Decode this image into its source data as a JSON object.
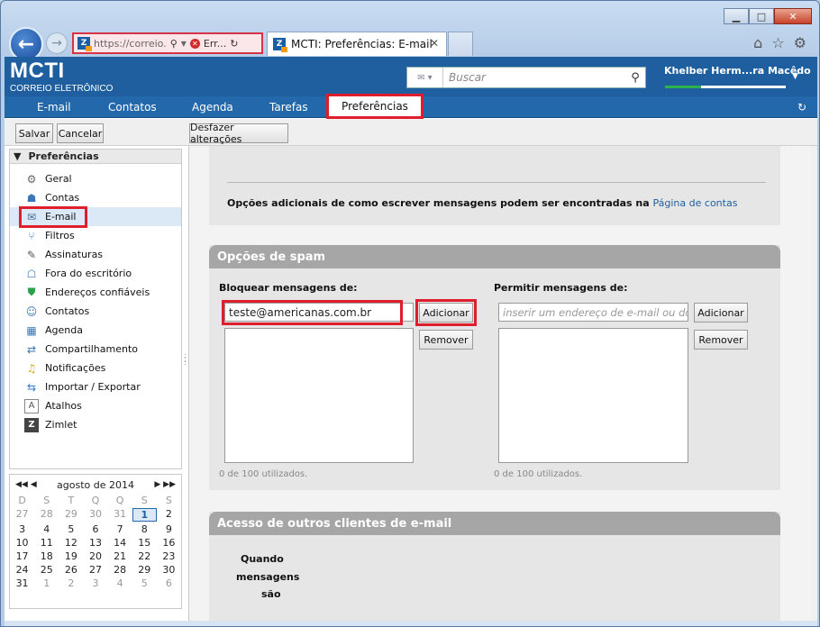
{
  "browser": {
    "address": "https://correio.",
    "error_tab_label": "Err...",
    "active_tab_title": "MCTI: Preferências: E-mail",
    "window_controls": [
      "minimize",
      "maximize",
      "close"
    ]
  },
  "app": {
    "logo": "MCTI",
    "logo_sub": "CORREIO ELETRÔNICO",
    "search_placeholder": "Buscar",
    "user_name": "Khelber Herm...ra Macêdo"
  },
  "nav": {
    "tabs": [
      {
        "label": "E-mail"
      },
      {
        "label": "Contatos"
      },
      {
        "label": "Agenda"
      },
      {
        "label": "Tarefas"
      },
      {
        "label": "Preferências"
      }
    ]
  },
  "toolbar": {
    "save": "Salvar",
    "cancel": "Cancelar",
    "undo": "Desfazer alterações"
  },
  "sidebar": {
    "title": "Preferências",
    "items": [
      {
        "label": "Geral",
        "icon": "gear-icon"
      },
      {
        "label": "Contas",
        "icon": "accounts-icon"
      },
      {
        "label": "E-mail",
        "icon": "mail-icon"
      },
      {
        "label": "Filtros",
        "icon": "filter-icon"
      },
      {
        "label": "Assinaturas",
        "icon": "signature-icon"
      },
      {
        "label": "Fora do escritório",
        "icon": "out-of-office-icon"
      },
      {
        "label": "Endereços confiáveis",
        "icon": "shield-icon"
      },
      {
        "label": "Contatos",
        "icon": "contacts-icon"
      },
      {
        "label": "Agenda",
        "icon": "calendar-icon"
      },
      {
        "label": "Compartilhamento",
        "icon": "sharing-icon"
      },
      {
        "label": "Notificações",
        "icon": "bell-icon"
      },
      {
        "label": "Importar / Exportar",
        "icon": "import-export-icon"
      },
      {
        "label": "Atalhos",
        "icon": "shortcuts-icon"
      },
      {
        "label": "Zimlet",
        "icon": "zimlet-icon"
      }
    ]
  },
  "calendar": {
    "month": "agosto de 2014",
    "days_header": [
      "D",
      "S",
      "T",
      "Q",
      "Q",
      "S",
      "S"
    ],
    "weeks": [
      [
        "27",
        "28",
        "29",
        "30",
        "31",
        "1",
        "2"
      ],
      [
        "3",
        "4",
        "5",
        "6",
        "7",
        "8",
        "9"
      ],
      [
        "10",
        "11",
        "12",
        "13",
        "14",
        "15",
        "16"
      ],
      [
        "17",
        "18",
        "19",
        "20",
        "21",
        "22",
        "23"
      ],
      [
        "24",
        "25",
        "26",
        "27",
        "28",
        "29",
        "30"
      ],
      [
        "31",
        "1",
        "2",
        "3",
        "4",
        "5",
        "6"
      ]
    ],
    "today": "1"
  },
  "main": {
    "compose_note": "Opções adicionais de como escrever mensagens podem ser encontradas na",
    "compose_link": "Página de contas",
    "spam": {
      "title": "Opções de spam",
      "block_label": "Bloquear mensagens de:",
      "block_value": "teste@americanas.com.br",
      "allow_label": "Permitir mensagens de:",
      "allow_placeholder": "inserir um endereço de e-mail ou do",
      "add": "Adicionar",
      "remove": "Remover",
      "block_usage": "0 de 100 utilizados.",
      "allow_usage": "0 de 100 utilizados."
    },
    "other_clients": {
      "title": "Acesso de outros clientes de e-mail",
      "when_label_1": "Quando",
      "when_label_2": "mensagens",
      "when_label_3": "são"
    }
  }
}
